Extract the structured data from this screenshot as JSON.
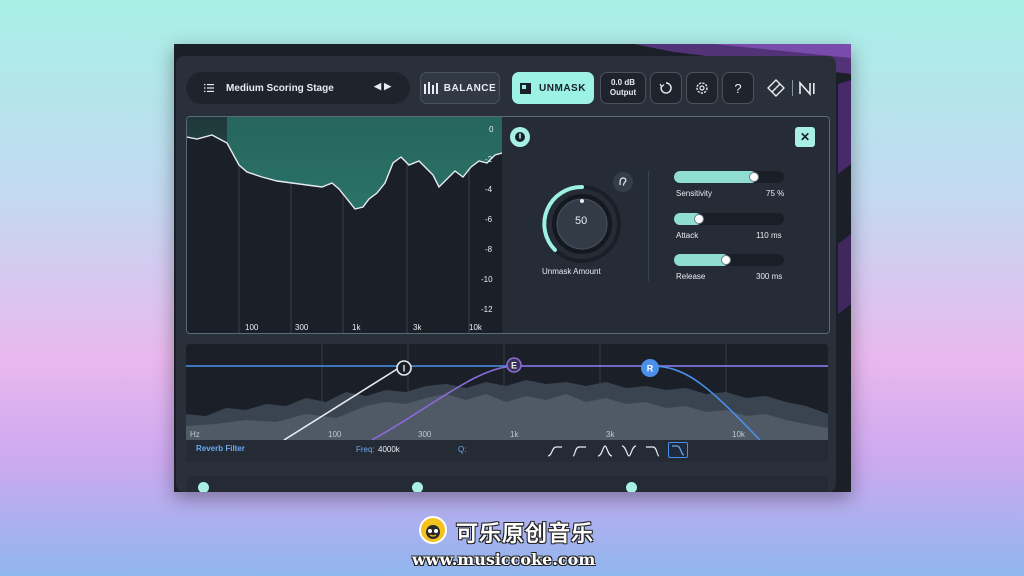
{
  "header": {
    "preset_name": "Medium Scoring Stage",
    "balance_label": "BALANCE",
    "unmask_label": "UNMASK",
    "output_value": "0.0 dB",
    "output_label": "Output",
    "help_label": "?"
  },
  "analyzer": {
    "db_ticks": [
      "0",
      "-2",
      "-4",
      "-6",
      "-8",
      "-10",
      "-12"
    ],
    "freq_ticks": [
      "100",
      "300",
      "1k",
      "3k",
      "10k"
    ]
  },
  "unmask_controls": {
    "knob_value": "50",
    "knob_label": "Unmask Amount",
    "close_label": "✕",
    "sensitivity": {
      "label": "Sensitivity",
      "value_text": "75 %",
      "level": 0.75
    },
    "attack": {
      "label": "Attack",
      "value_text": "110 ms",
      "level": 0.25
    },
    "release": {
      "label": "Release",
      "value_text": "300 ms",
      "level": 0.5
    }
  },
  "filter": {
    "unit_label": "Hz",
    "freq_ticks": [
      "100",
      "300",
      "1k",
      "3k",
      "10k"
    ],
    "nodes": [
      "I",
      "E",
      "R"
    ],
    "section_label": "Reverb Filter",
    "freq_label": "Freq:",
    "freq_value": "4000k",
    "q_label": "Q:"
  },
  "watermark": {
    "brand_cn": "可乐原创音乐",
    "url": "www.musiccoke.com"
  },
  "colors": {
    "accent_teal": "#9cf2e4",
    "node_purple": "#8a6ad8",
    "node_blue": "#4a90e8"
  }
}
